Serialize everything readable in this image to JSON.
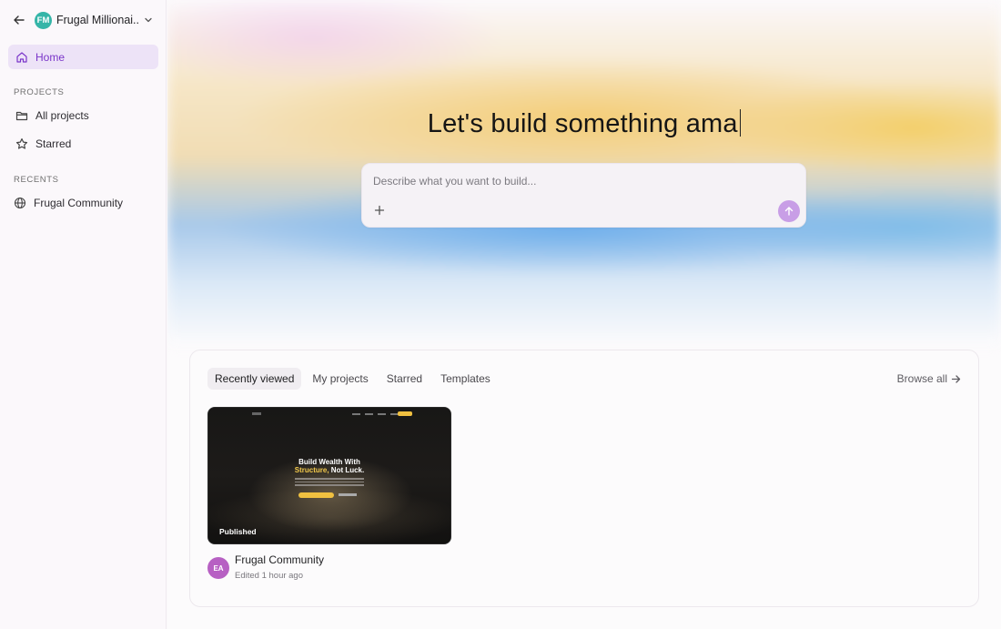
{
  "workspace": {
    "initials": "FM",
    "name": "Frugal Millionai..."
  },
  "nav": {
    "home": "Home",
    "projects_section": "PROJECTS",
    "all_projects": "All projects",
    "starred": "Starred",
    "recents_section": "RECENTS",
    "recent_items": [
      "Frugal Community"
    ]
  },
  "hero": {
    "title": "Let's build something ama",
    "placeholder": "Describe what you want to build..."
  },
  "projects_panel": {
    "tabs": [
      "Recently viewed",
      "My projects",
      "Starred",
      "Templates"
    ],
    "active_tab": "Recently viewed",
    "browse_all": "Browse all",
    "cards": [
      {
        "name": "Frugal Community",
        "edited": "Edited 1 hour ago",
        "status": "Published",
        "owner_initials": "EA",
        "preview_headline_1": "Build Wealth With",
        "preview_headline_2a": "Structure,",
        "preview_headline_2b": " Not Luck."
      }
    ]
  },
  "colors": {
    "accent": "#7a35c9",
    "active_nav_bg": "#ede3f7",
    "workspace_avatar": "#35b5a8",
    "owner_avatar": "#b760c3",
    "send_button": "#c89ee6"
  }
}
